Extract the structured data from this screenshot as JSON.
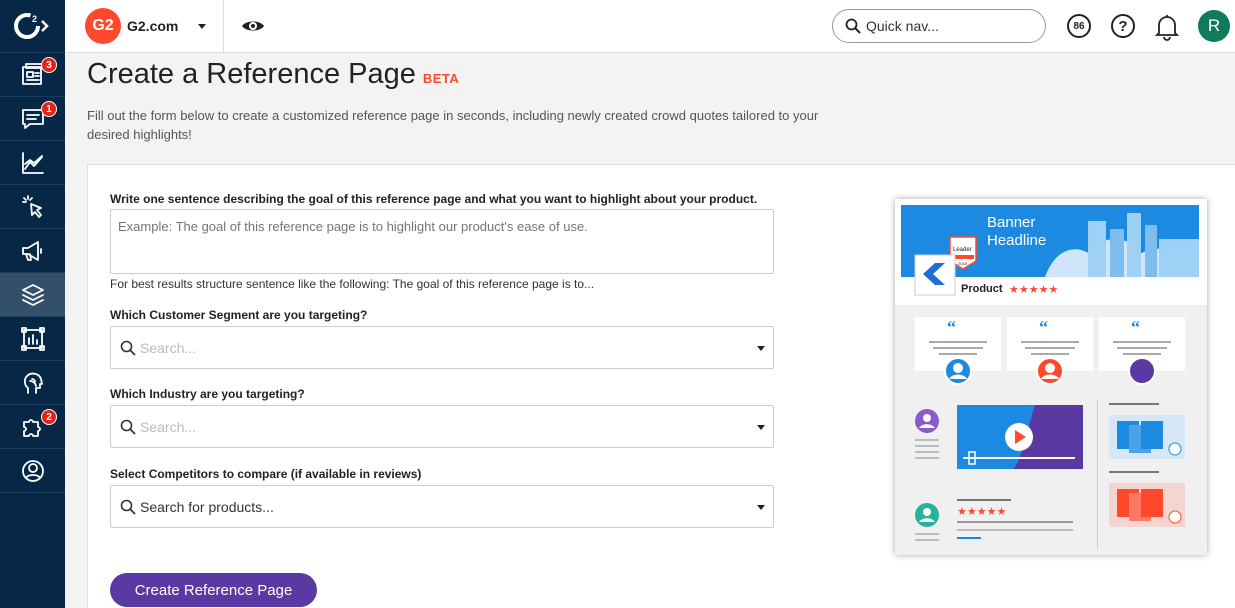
{
  "topbar": {
    "site_name": "G2.com",
    "brand_logo_text": "G2",
    "quicknav_placeholder": "Quick nav...",
    "score": "86",
    "help_glyph": "?",
    "avatar_initial": "R"
  },
  "sidebar": {
    "items": [
      {
        "icon": "reviews-icon",
        "badge": "3"
      },
      {
        "icon": "chat-icon",
        "badge": "1"
      },
      {
        "icon": "analytics-icon",
        "badge": ""
      },
      {
        "icon": "pointer-icon",
        "badge": ""
      },
      {
        "icon": "megaphone-icon",
        "badge": ""
      },
      {
        "icon": "layers-icon",
        "badge": "",
        "active": true
      },
      {
        "icon": "report-icon",
        "badge": ""
      },
      {
        "icon": "head-icon",
        "badge": ""
      },
      {
        "icon": "puzzle-icon",
        "badge": "2"
      },
      {
        "icon": "profile-icon",
        "badge": ""
      }
    ]
  },
  "page": {
    "title": "Create a Reference Page",
    "beta": "BETA",
    "description": "Fill out the form below to create a customized reference page in seconds, including newly created crowd quotes tailored to your desired highlights!"
  },
  "form": {
    "goal_label": "Write one sentence describing the goal of this reference page and what you want to highlight about your product.",
    "goal_placeholder": "Example: The goal of this reference page is to highlight our product's ease of use.",
    "goal_hint": "For best results structure sentence like the following: The goal of this reference page is to...",
    "segment_label": "Which Customer Segment are you targeting?",
    "segment_placeholder": "Search...",
    "industry_label": "Which Industry are you targeting?",
    "industry_placeholder": "Search...",
    "competitors_label": "Select Competitors to compare (if available in reviews)",
    "competitors_placeholder": "Search for products...",
    "submit_label": "Create Reference Page"
  },
  "illustration": {
    "banner_line1": "Banner",
    "banner_line2": "Headline",
    "badge_text": "Leader",
    "badge_year": "2018",
    "product_label": "Product",
    "stars": "★★★★★",
    "colors": {
      "banner": "#1c8ae0",
      "accent_red": "#ff492c",
      "purple": "#5a39a2",
      "teal": "#27b39b"
    }
  },
  "colors": {
    "sidebar": "#062846",
    "brand": "#ff492c",
    "primary_button": "#5a39a2",
    "avatar": "#0f7b5c"
  }
}
